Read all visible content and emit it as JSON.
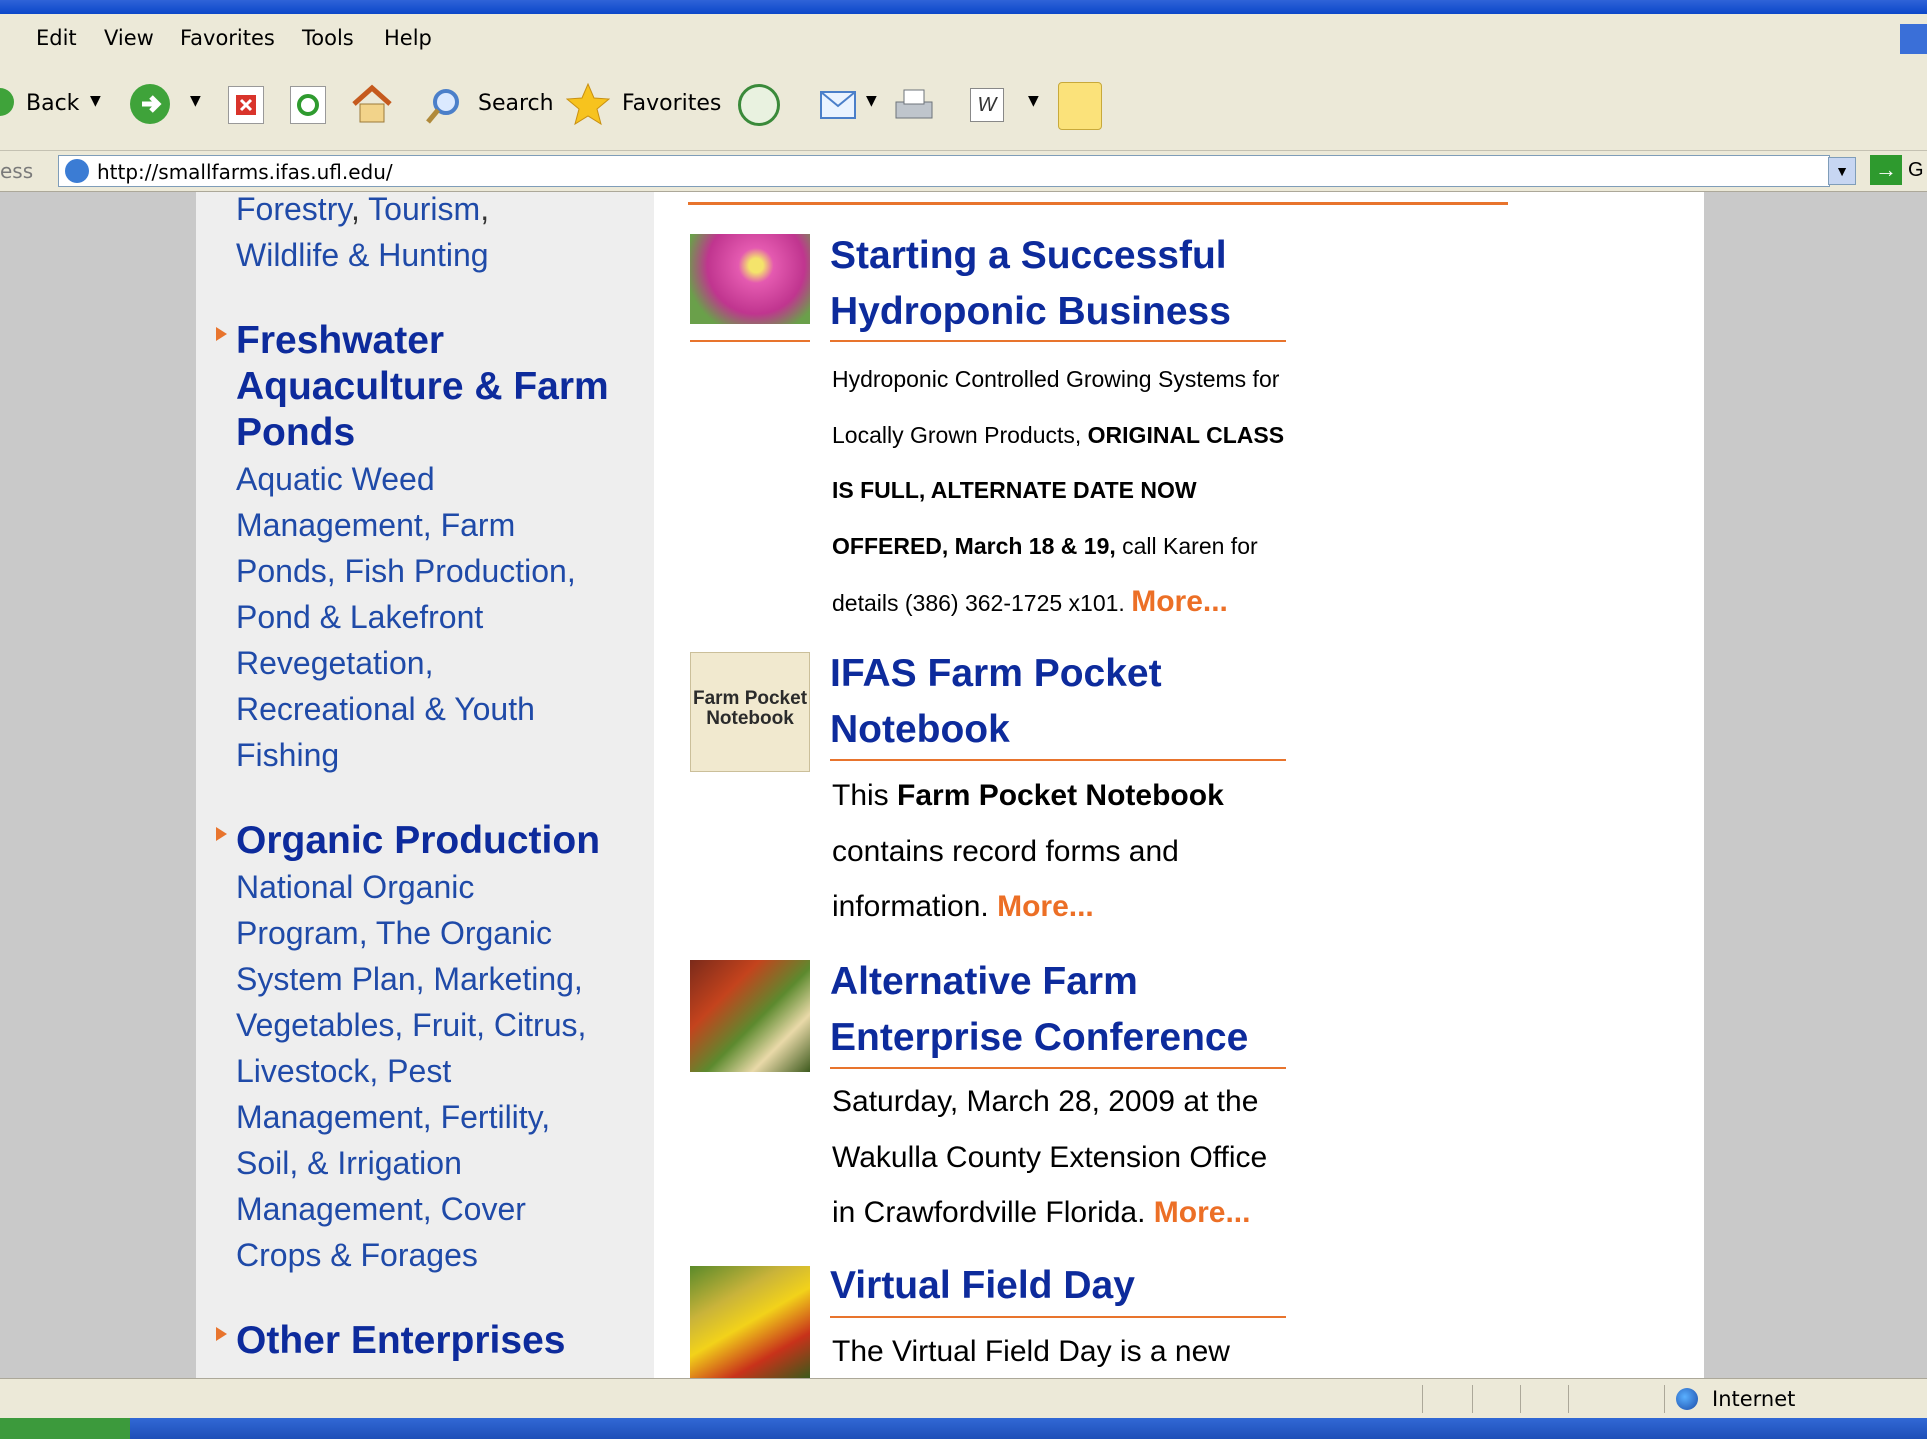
{
  "menu": [
    "Edit",
    "View",
    "Favorites",
    "Tools",
    "Help"
  ],
  "toolbar": {
    "back_label": "Back",
    "search_label": "Search",
    "favorites_label": "Favorites"
  },
  "address": {
    "label": "ess",
    "url": "http://smallfarms.ifas.ufl.edu/",
    "go_label": "G"
  },
  "sidebar": {
    "top_links": [
      "Forestry",
      "Tourism",
      "Wildlife & Hunting"
    ],
    "sections": [
      {
        "title": "Freshwater Aquaculture & Farm Ponds",
        "title_lines": [
          "Freshwater",
          "Aquaculture & Farm",
          "Ponds"
        ],
        "link_lines": [
          "Aquatic Weed",
          "Management, Farm",
          "Ponds, Fish Production,",
          "Pond & Lakefront",
          "Revegetation,",
          "Recreational & Youth",
          "Fishing"
        ]
      },
      {
        "title": "Organic Production",
        "title_lines": [
          "Organic Production"
        ],
        "link_lines": [
          "National Organic",
          "Program, The Organic",
          "System Plan, Marketing,",
          "Vegetables, Fruit, Citrus,",
          "Livestock, Pest",
          "Management, Fertility,",
          "Soil, & Irrigation",
          "Management, Cover",
          "Crops & Forages"
        ]
      },
      {
        "title": "Other Enterprises",
        "title_lines": [
          "Other Enterprises"
        ],
        "link_lines": []
      }
    ]
  },
  "news": [
    {
      "title_lines": [
        "Starting a Successful",
        "Hydroponic Business"
      ],
      "body_plain_1": "Hydroponic Controlled Growing Systems for Locally Grown Products, ",
      "body_bold": "ORIGINAL CLASS IS FULL, ALTERNATE DATE NOW OFFERED, March 18 & 19,",
      "body_plain_2": " call Karen for details (386) 362-1725 x101. ",
      "more": "More..."
    },
    {
      "title_lines": [
        "IFAS Farm Pocket",
        "Notebook"
      ],
      "body_plain_1": "This ",
      "body_bold": "Farm Pocket Notebook",
      "body_plain_2": " contains record forms and information. ",
      "more": "More...",
      "thumb_text_1": "Farm Pocket",
      "thumb_text_2": "Notebook"
    },
    {
      "title_lines": [
        "Alternative Farm",
        "Enterprise Conference"
      ],
      "body_plain_1": "Saturday, March 28, 2009 at the Wakulla County Extension Office in Crawfordville Florida. ",
      "more": "More..."
    },
    {
      "title_lines": [
        "Virtual Field Day"
      ],
      "body_plain_1": "The Virtual Field Day is a new"
    }
  ],
  "status": {
    "zone": "Internet"
  }
}
